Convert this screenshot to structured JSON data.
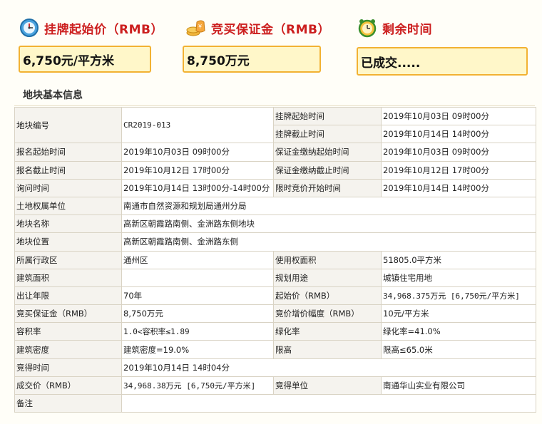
{
  "stats": [
    {
      "label": "挂牌起始价（RMB）",
      "icon": "clock-gauge-icon",
      "value": "6,750元/平方米"
    },
    {
      "label": "竞买保证金（RMB）",
      "icon": "money-bag-icon",
      "value": "8,750万元"
    },
    {
      "label": "剩余时间",
      "icon": "alarm-clock-icon",
      "value": "已成交....."
    }
  ],
  "section_title": "地块基本信息",
  "rows": {
    "r1": {
      "l1": "地块编号",
      "v1": "CR2019-013",
      "l2": "挂牌起始时间",
      "v2": "2019年10月03日 09时00分"
    },
    "r2": {
      "l2": "挂牌截止时间",
      "v2": "2019年10月14日 14时00分"
    },
    "r3": {
      "l1": "报名起始时间",
      "v1": "2019年10月03日 09时00分",
      "l2": "保证金缴纳起始时间",
      "v2": "2019年10月03日 09时00分"
    },
    "r4": {
      "l1": "报名截止时间",
      "v1": "2019年10月12日 17时00分",
      "l2": "保证金缴纳截止时间",
      "v2": "2019年10月12日 17时00分"
    },
    "r5": {
      "l1": "询问时间",
      "v1": "2019年10月14日 13时00分-14时00分",
      "l2": "限时竞价开始时间",
      "v2": "2019年10月14日 14时00分"
    },
    "r6": {
      "l1": "土地权属单位",
      "v1": "南通市自然资源和规划局通州分局"
    },
    "r7": {
      "l1": "地块名称",
      "v1": "高新区朝霞路南侧、金洲路东侧地块"
    },
    "r8": {
      "l1": "地块位置",
      "v1": "高新区朝霞路南侧、金洲路东侧"
    },
    "r9": {
      "l1": "所属行政区",
      "v1": "通州区",
      "l2": "使用权面积",
      "v2": "51805.0平方米"
    },
    "r10": {
      "l1": "建筑面积",
      "v1": "",
      "l2": "规划用途",
      "v2": "城镇住宅用地"
    },
    "r11": {
      "l1": "出让年限",
      "v1": "70年",
      "l2": "起始价（RMB）",
      "v2": "34,968.375万元 [6,750元/平方米]"
    },
    "r12": {
      "l1": "竞买保证金（RMB）",
      "v1": "8,750万元",
      "l2": "竞价增价幅度（RMB）",
      "v2": "10元/平方米"
    },
    "r13": {
      "l1": "容积率",
      "v1": "1.0<容积率≤1.89",
      "l2": "绿化率",
      "v2": "绿化率=41.0%"
    },
    "r14": {
      "l1": "建筑密度",
      "v1": "建筑密度=19.0%",
      "l2": "限高",
      "v2": "限高≤65.0米"
    },
    "r15": {
      "l1": "竞得时间",
      "v1": "2019年10月14日 14时04分"
    },
    "r16": {
      "l1": "成交价（RMB）",
      "v1": "34,968.38万元 [6,750元/平方米]",
      "l2": "竞得单位",
      "v2": "南通华山实业有限公司"
    },
    "r17": {
      "l1": "备注",
      "v1": ""
    }
  }
}
